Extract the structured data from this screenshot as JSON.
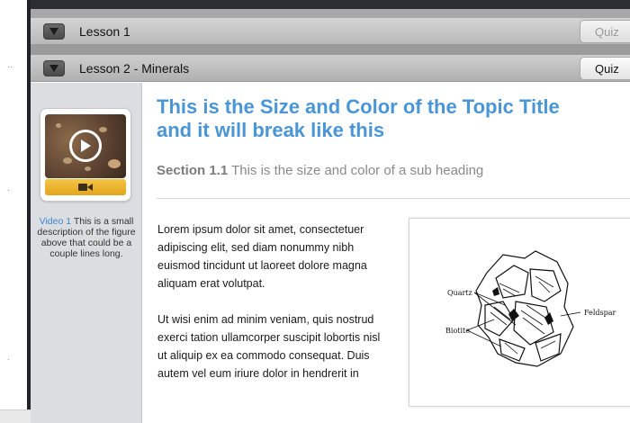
{
  "lessons": [
    {
      "title": "Lesson 1",
      "quiz_label": "Quiz",
      "quiz_enabled": false
    },
    {
      "title": "Lesson 2 - Minerals",
      "quiz_label": "Quiz",
      "quiz_enabled": true
    }
  ],
  "sidebar": {
    "video": {
      "icon": "play-icon",
      "bar_icon": "video-camera-icon",
      "caption_label": "Video 1",
      "caption_text": " This is a small description of the figure above that could be a couple lines long."
    }
  },
  "content": {
    "topic_title_line1": "This is the Size and Color of the Topic Title",
    "topic_title_line2": "and it will break like this",
    "sub_heading_bold": "Section 1.1",
    "sub_heading_text": " This is the size and color of a sub heading",
    "paragraph_1": "Lorem ipsum dolor sit amet, consectetuer adipiscing elit, sed diam nonummy nibh euismod tincidunt ut laoreet dolore magna aliquam erat volutpat.",
    "paragraph_2": "Ut wisi enim ad minim veniam, quis nostrud exerci tation ullamcorper suscipit lobortis nisl ut aliquip ex ea commodo consequat. Duis autem vel eum iriure dolor in hendrerit in",
    "figure": {
      "labels": {
        "quartz": "Quartz",
        "biotite": "Biotite",
        "feldspar": "Feldspar"
      }
    }
  },
  "colors": {
    "title_blue": "#4a95d6",
    "video_label_blue": "#3a86d1",
    "video_bar_yellow": "#f0b733"
  }
}
